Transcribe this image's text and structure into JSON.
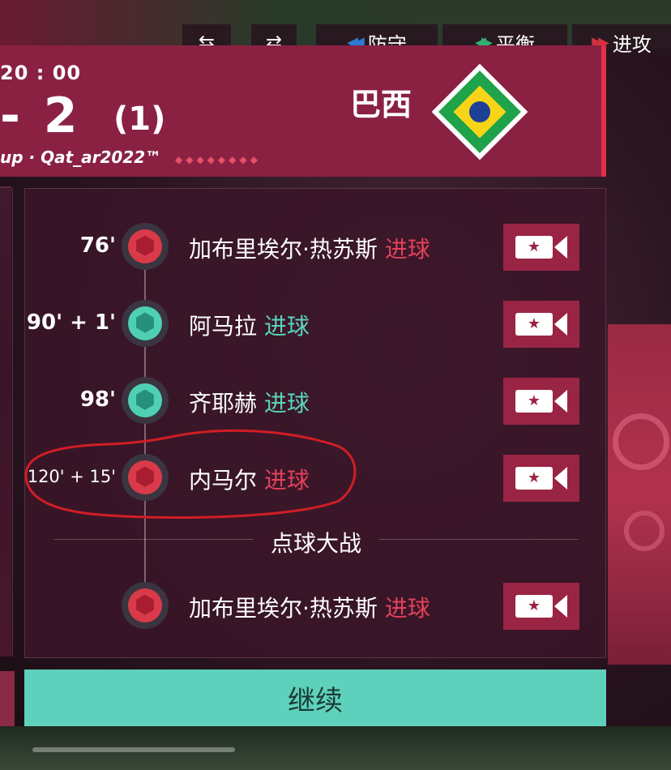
{
  "controls": {
    "defend_label": "防守",
    "balance_label": "平衡",
    "attack_label": "进攻"
  },
  "scoreboard": {
    "time": "20 : 00",
    "score": "- 2",
    "penalty_score": "(1)",
    "brand": "up · Qat_ar2022™",
    "team_name": "巴西"
  },
  "events": [
    {
      "minute": "76'",
      "player": "加布里埃尔·热苏斯",
      "type": "进球",
      "team": "red"
    },
    {
      "minute": "90' + 1'",
      "player": "阿马拉",
      "type": "进球",
      "team": "teal"
    },
    {
      "minute": "98'",
      "player": "齐耶赫",
      "type": "进球",
      "team": "teal"
    },
    {
      "minute": "120' + 15'",
      "player": "内马尔",
      "type": "进球",
      "team": "red"
    }
  ],
  "penalty_section": {
    "label": "点球大战",
    "events": [
      {
        "minute": "",
        "player": "加布里埃尔·热苏斯",
        "type": "进球",
        "team": "red"
      }
    ]
  },
  "continue_label": "继续",
  "colors": {
    "home_accent": "#d93a4a",
    "away_accent": "#4fd0b4",
    "header_bg": "#8a2142",
    "continue_bg": "#5dd1bb"
  },
  "icons": [
    "back-arrow-icon",
    "substitution-icon",
    "football-icon",
    "video-replay-icon",
    "brazil-flag-icon"
  ]
}
